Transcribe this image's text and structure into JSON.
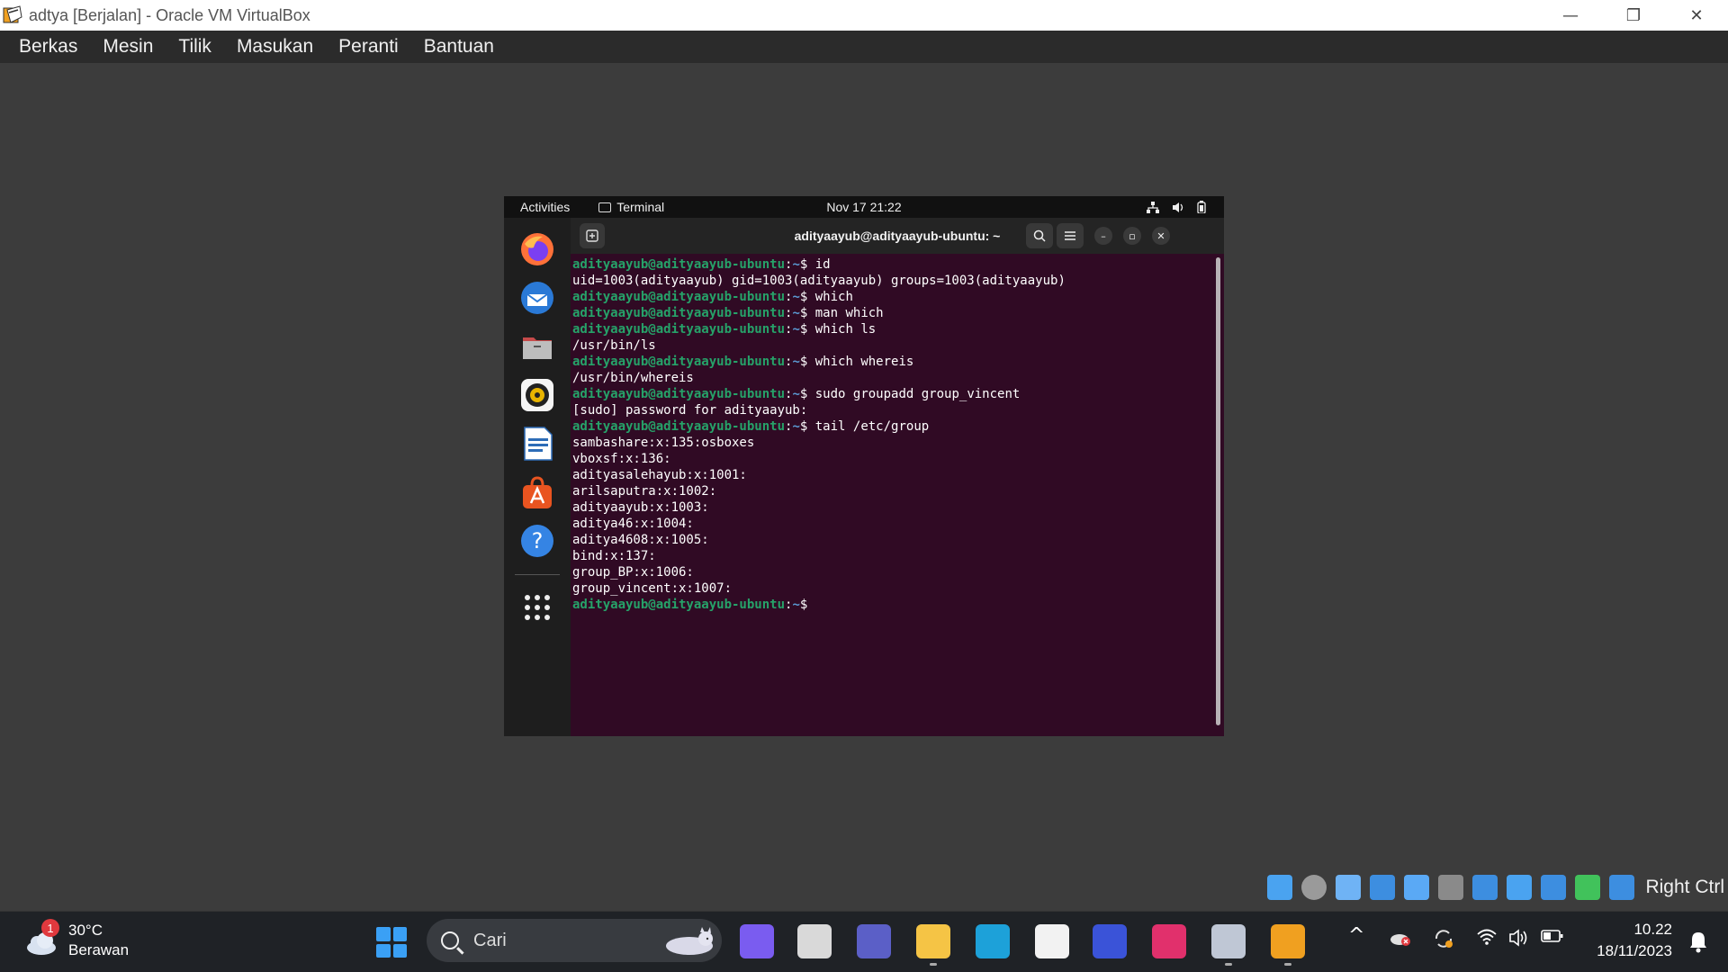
{
  "host_window": {
    "title": "adtya [Berjalan] - Oracle VM VirtualBox",
    "controls": {
      "minimize": "—",
      "restore": "❐",
      "close": "✕"
    }
  },
  "host_menu": [
    "Berkas",
    "Mesin",
    "Tilik",
    "Masukan",
    "Peranti",
    "Bantuan"
  ],
  "gnome": {
    "activities": "Activities",
    "app_name": "Terminal",
    "clock": "Nov 17  21:22"
  },
  "dock_apps": [
    {
      "name": "firefox-icon",
      "color": "#ff7139"
    },
    {
      "name": "thunderbird-icon",
      "color": "#2a79d6"
    },
    {
      "name": "files-icon",
      "color": "#a5a5a5"
    },
    {
      "name": "rhythmbox-icon",
      "color": "#e8b400"
    },
    {
      "name": "libreoffice-writer-icon",
      "color": "#2d6cb7"
    },
    {
      "name": "app-center-icon",
      "color": "#e95420"
    },
    {
      "name": "help-icon",
      "color": "#3584e4"
    }
  ],
  "terminal": {
    "title": "adityaayub@adityaayub-ubuntu: ~",
    "prompt_user": "adityaayub@adityaayub-ubuntu",
    "prompt_path": "~",
    "lines": [
      {
        "type": "cmd",
        "text": "id"
      },
      {
        "type": "out",
        "text": "uid=1003(adityaayub) gid=1003(adityaayub) groups=1003(adityaayub)"
      },
      {
        "type": "cmd",
        "text": "which"
      },
      {
        "type": "cmd",
        "text": "man which"
      },
      {
        "type": "cmd",
        "text": "which ls"
      },
      {
        "type": "out",
        "text": "/usr/bin/ls"
      },
      {
        "type": "cmd",
        "text": "which whereis"
      },
      {
        "type": "out",
        "text": "/usr/bin/whereis"
      },
      {
        "type": "cmd",
        "text": "sudo groupadd group_vincent"
      },
      {
        "type": "out",
        "text": "[sudo] password for adityaayub:"
      },
      {
        "type": "cmd",
        "text": "tail /etc/group"
      },
      {
        "type": "out",
        "text": "sambashare:x:135:osboxes"
      },
      {
        "type": "out",
        "text": "vboxsf:x:136:"
      },
      {
        "type": "out",
        "text": "adityasalehayub:x:1001:"
      },
      {
        "type": "out",
        "text": "arilsaputra:x:1002:"
      },
      {
        "type": "out",
        "text": "adityaayub:x:1003:"
      },
      {
        "type": "out",
        "text": "aditya46:x:1004:"
      },
      {
        "type": "out",
        "text": "aditya4608:x:1005:"
      },
      {
        "type": "out",
        "text": "bind:x:137:"
      },
      {
        "type": "out",
        "text": "group_BP:x:1006:"
      },
      {
        "type": "out",
        "text": "group_vincent:x:1007:"
      },
      {
        "type": "cmd",
        "text": ""
      }
    ]
  },
  "vbox_status": {
    "host_key": "Right Ctrl",
    "icons": [
      {
        "name": "hard-disk-icon",
        "color": "#4aa3f0"
      },
      {
        "name": "optical-drive-icon",
        "color": "#9a9a9a"
      },
      {
        "name": "audio-icon",
        "color": "#6fb3f5"
      },
      {
        "name": "network-icon",
        "color": "#3d8ee0"
      },
      {
        "name": "usb-icon",
        "color": "#5aa9f5"
      },
      {
        "name": "shared-folders-icon",
        "color": "#8a8a8a"
      },
      {
        "name": "display-icon",
        "color": "#3d8ee0"
      },
      {
        "name": "recording-icon",
        "color": "#4aa3f0"
      },
      {
        "name": "vt-x-icon",
        "color": "#3d8ee0"
      },
      {
        "name": "mouse-integration-icon",
        "color": "#41c25b"
      },
      {
        "name": "keyboard-capture-icon",
        "color": "#3d8ee0"
      }
    ]
  },
  "taskbar": {
    "weather": {
      "temp": "30°C",
      "desc": "Berawan",
      "badge": "1"
    },
    "search_placeholder": "Cari",
    "apps": [
      {
        "name": "copilot-icon",
        "color": "#7a5cf0"
      },
      {
        "name": "task-view-icon",
        "color": "#d9d9d9"
      },
      {
        "name": "teams-chat-icon",
        "color": "#5b5fc7"
      },
      {
        "name": "file-explorer-icon",
        "color": "#f5c445"
      },
      {
        "name": "edge-icon",
        "color": "#1da1d9"
      },
      {
        "name": "microsoft-store-icon",
        "color": "#f2f2f2"
      },
      {
        "name": "visual-studio-icon",
        "color": "#3a53d8"
      },
      {
        "name": "instagram-icon",
        "color": "#e1306c"
      },
      {
        "name": "virtualbox-manager-icon",
        "color": "#bfc7d5"
      },
      {
        "name": "virtualbox-vm-icon",
        "color": "#f0a020"
      }
    ],
    "tray": {
      "chevron": "^"
    },
    "clock": {
      "time": "10.22",
      "date": "18/11/2023"
    }
  }
}
